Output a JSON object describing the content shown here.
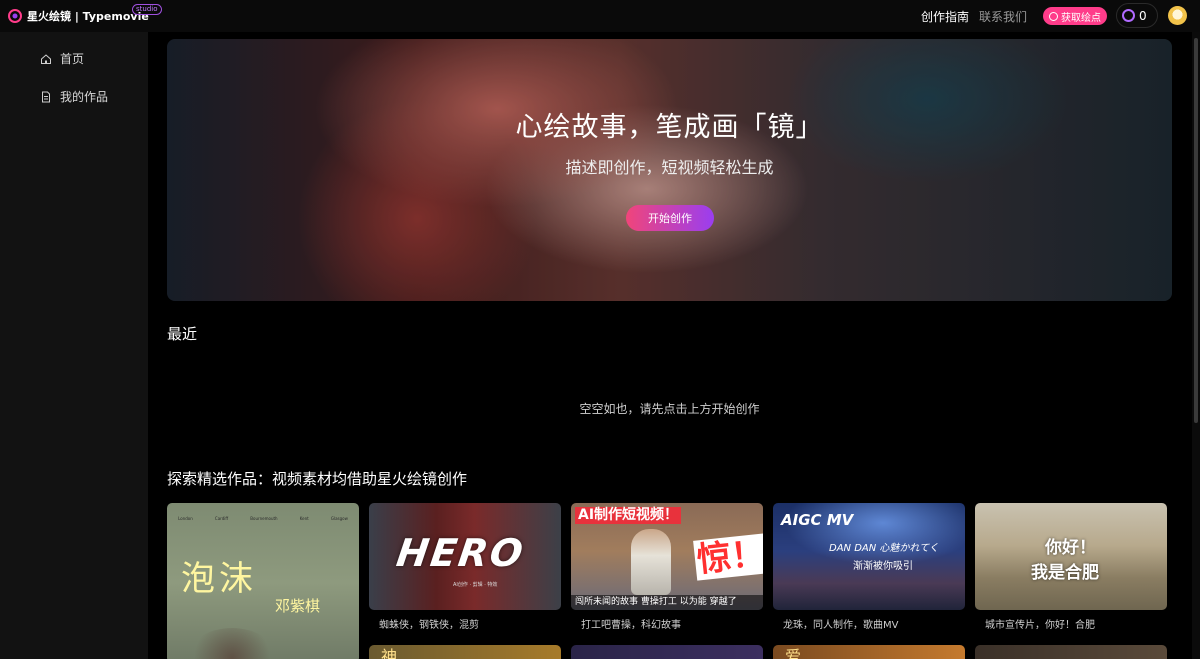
{
  "header": {
    "brand": "星火绘镜 | Typemovie",
    "brand_badge": "studio",
    "nav_guide": "创作指南",
    "nav_contact": "联系我们",
    "get_points": "获取绘点",
    "balance": "0"
  },
  "sidebar": {
    "items": [
      {
        "label": "首页",
        "icon": "home-icon"
      },
      {
        "label": "我的作品",
        "icon": "document-icon"
      }
    ]
  },
  "hero": {
    "title": "心绘故事，笔成画「镜」",
    "subtitle": "描述即创作，短视频轻松生成",
    "cta": "开始创作"
  },
  "recent": {
    "title": "最近",
    "empty": "空空如也，请先点击上方开始创作"
  },
  "explore": {
    "title": "探索精选作品：视频素材均借助星火绘镜创作",
    "cards": [
      {
        "caption": "",
        "thumb_title": "泡沫",
        "thumb_name": "邓紫棋",
        "thumb_cities": [
          "London",
          "Cardiff",
          "Bournemouth",
          "Kent",
          "Glasgow"
        ]
      },
      {
        "caption": "蜘蛛侠，钢铁侠，混剪",
        "thumb_title": "HERO",
        "thumb_sub": "AI创作 · 剪辑 · 特效"
      },
      {
        "caption": "打工吧曹操，科幻故事",
        "thumb_title": "AI制作短视频！",
        "thumb_shock": "惊！",
        "thumb_bottom": "闯所未闻的故事 曹操打工 以为能 穿越了"
      },
      {
        "caption": "龙珠，同人制作，歌曲MV",
        "thumb_title": "AIGC MV",
        "thumb_sub": "DAN DAN 心魅かれてく",
        "thumb_sub2": "渐渐被你吸引"
      },
      {
        "caption": "城市宣传片，你好！合肥",
        "thumb_title": "你好！",
        "thumb_sub": "我是合肥"
      }
    ],
    "peek_chars": [
      "神",
      "",
      "爱",
      ""
    ]
  },
  "colors": {
    "accent_pink": "#ff3c8a",
    "accent_purple": "#9a3ef0",
    "background": "#000000",
    "sidebar": "#121212"
  }
}
